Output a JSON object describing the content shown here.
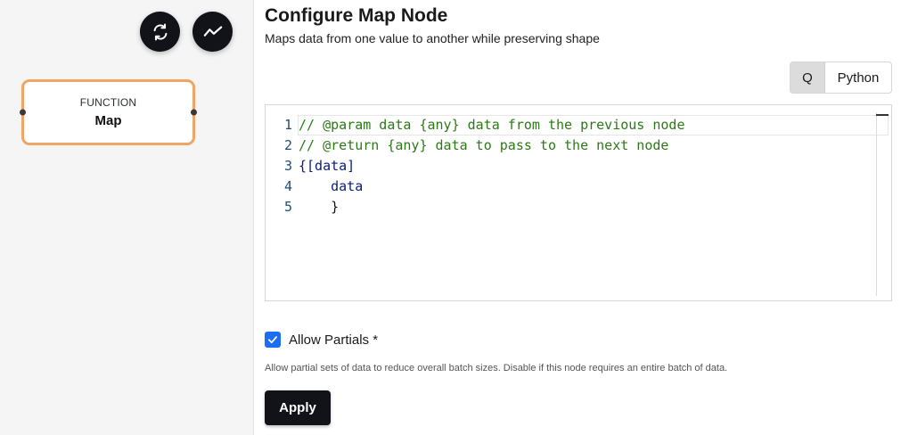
{
  "canvas": {
    "toolbar": {
      "refresh_icon": "refresh-icon",
      "trend_icon": "trend-line-icon"
    },
    "node": {
      "type": "FUNCTION",
      "name": "Map",
      "border_color": "#f0a564"
    }
  },
  "panel": {
    "title": "Configure Map Node",
    "subtitle": "Maps data from one value to another while preserving shape",
    "language_toggle": {
      "options": [
        "Q",
        "Python"
      ],
      "selected": "Q"
    },
    "editor": {
      "line_numbers": [
        "1",
        "2",
        "3",
        "4",
        "5"
      ],
      "lines": [
        "// @param data {any} data from the previous node",
        "// @return {any} data to pass to the next node",
        "{[data]",
        "    data",
        "    }"
      ]
    },
    "allow_partials": {
      "label": "Allow Partials *",
      "checked": true,
      "hint": "Allow partial sets of data to reduce overall batch sizes. Disable if this node requires an entire batch of data."
    },
    "apply_label": "Apply"
  },
  "colors": {
    "accent": "#1c6df2",
    "dark_button": "#111318",
    "comment": "#2b7a16"
  }
}
